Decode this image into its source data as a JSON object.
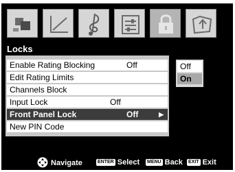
{
  "tabs": [
    {
      "icon": "picture-icon"
    },
    {
      "icon": "screen-icon"
    },
    {
      "icon": "audio-icon"
    },
    {
      "icon": "setup-icon"
    },
    {
      "icon": "lock-icon",
      "selected": true
    },
    {
      "icon": "applications-icon"
    }
  ],
  "panel": {
    "title": "Locks",
    "items": [
      {
        "label": "Enable Rating Blocking",
        "value": "Off"
      },
      {
        "label": "Edit Rating Limits",
        "value": ""
      },
      {
        "label": "Channels Block",
        "value": ""
      },
      {
        "label": "Input Lock",
        "value": "Off"
      },
      {
        "label": "Front Panel Lock",
        "value": "Off",
        "highlighted": true
      },
      {
        "label": "New PIN Code",
        "value": ""
      }
    ]
  },
  "submenu": {
    "options": [
      "Off",
      "On"
    ],
    "selected": "On"
  },
  "footer": {
    "navigate": "Navigate",
    "enter_key": "ENTER",
    "select": "Select",
    "menu_key": "MENU",
    "back": "Back",
    "exit_key": "EXIT",
    "exit": "Exit"
  },
  "colors": {
    "background": "#000000",
    "highlight": "#3c3c3c",
    "item_bg": "#ffffff"
  }
}
